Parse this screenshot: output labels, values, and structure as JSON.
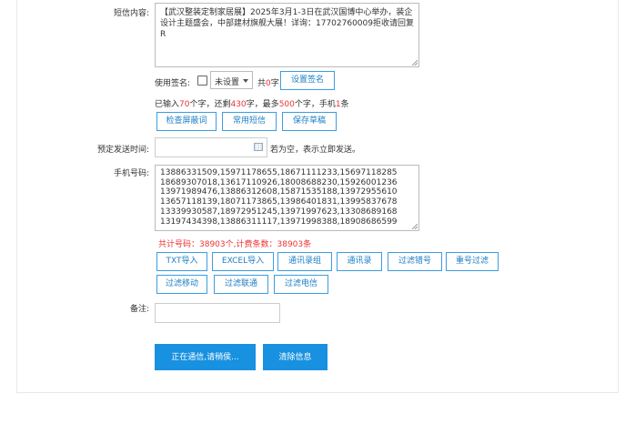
{
  "sms": {
    "label": "短信内容:",
    "content": "【武汉整装定制家居展】2025年3月1-3日在武汉国博中心举办，装企设计主题盛会，中部建材旗舰大展！详询：17702760009拒收请回复R"
  },
  "signature": {
    "label": "使用签名:",
    "select_value": "未设置",
    "count_prefix": "共",
    "count_value": "0",
    "count_suffix": "字",
    "set_button": "设置签名"
  },
  "stats": {
    "p1": "已输入",
    "entered": "70",
    "p2": "个字，还剩",
    "remaining": "430",
    "p3": "字，最多",
    "max": "500",
    "p4": "个字，手机",
    "msg_count": "1",
    "p5": "条"
  },
  "actions": {
    "check": "检查屏蔽词",
    "common": "常用短信",
    "draft": "保存草稿"
  },
  "schedule": {
    "label": "预定发送时间:",
    "value": "",
    "hint": "若为空，表示立即发送。"
  },
  "phones": {
    "label": "手机号码:",
    "content": "13886331509,15971178655,18671111233,15697118285\n18689307018,13617110926,18008688230,15926001236\n13971989476,13886312608,15871535188,13972955610\n13657118139,18071173865,13986401831,13995837678\n13339930587,18972951245,13971997623,13308689168\n13197434398,13886311117,13971998388,18908686599",
    "summary": "共计号码：38903个,计费条数：38903条"
  },
  "import_buttons": [
    "TXT导入",
    "EXCEL导入",
    "通讯录组",
    "通讯录",
    "过滤错号",
    "重号过滤"
  ],
  "filter_buttons": [
    "过滤移动",
    "过滤联通",
    "过滤电信"
  ],
  "remark": {
    "label": "备注:",
    "value": ""
  },
  "submit": {
    "sending": "正在通信,请稍侯...",
    "clear": "清除信息"
  },
  "colors": {
    "accent": "#1891e0",
    "highlight": "#e33333"
  }
}
